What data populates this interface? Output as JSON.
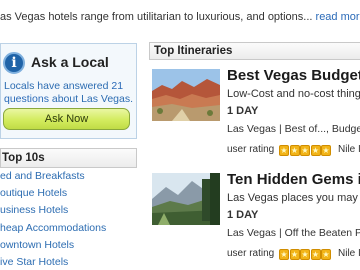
{
  "intro": {
    "text": "as Vegas hotels range from utilitarian to luxurious, and options...",
    "read_more": "read more"
  },
  "ask_local": {
    "title": "Ask a Local",
    "text_before": "Locals have answered ",
    "count": "21",
    "text_link": "questions",
    "text_after": " about Las Vegas.",
    "button": "Ask Now",
    "colors": {
      "accent": "#1f63a8",
      "button": "#d3ec5f"
    }
  },
  "top10": {
    "title": "Top 10s",
    "items": [
      "ed and Breakfasts",
      "outique Hotels",
      "usiness Hotels",
      "heap Accommodations",
      "owntown Hotels",
      "ive Star Hotels"
    ]
  },
  "itineraries": {
    "title": "Top Itineraries",
    "cards": [
      {
        "title": "Best Vegas Budget",
        "subtitle": "Low-Cost and no-cost things",
        "duration": "1 DAY",
        "tags": "Las Vegas  |  Best of...,  Budge",
        "rating_label": "user rating",
        "rating": 5,
        "author": "Nile I",
        "photo_icon": "desert-canyon-photo"
      },
      {
        "title": "Ten Hidden Gems i",
        "subtitle": "Las Vegas places you may n",
        "duration": "1 DAY",
        "tags": "Las Vegas  |  Off the Beaten P",
        "rating_label": "user rating",
        "rating": 5,
        "author": "Nile I",
        "photo_icon": "mountain-meadow-photo"
      }
    ]
  }
}
